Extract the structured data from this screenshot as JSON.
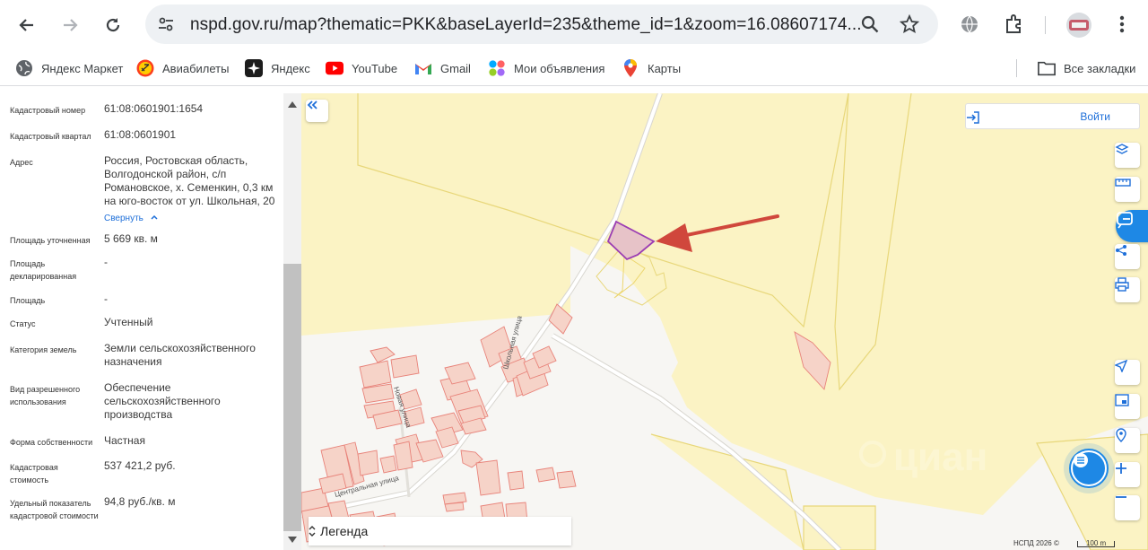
{
  "browser": {
    "url": "nspd.gov.ru/map?thematic=PKK&baseLayerId=235&theme_id=1&zoom=16.08607174...",
    "bookmarks": [
      {
        "label": "Яндекс Маркет",
        "icon": "globe-icon"
      },
      {
        "label": "Авиабилеты",
        "icon": "flight-icon"
      },
      {
        "label": "Яндекс",
        "icon": "yandex-icon"
      },
      {
        "label": "YouTube",
        "icon": "youtube-icon"
      },
      {
        "label": "Gmail",
        "icon": "gmail-icon"
      },
      {
        "label": "Мои объявления",
        "icon": "dots-icon"
      },
      {
        "label": "Карты",
        "icon": "maps-pin-icon"
      }
    ],
    "all_bookmarks_label": "Все закладки"
  },
  "panel": {
    "rows": [
      {
        "label": "Кадастровый номер",
        "value": "61:08:0601901:1654"
      },
      {
        "label": "Кадастровый квартал",
        "value": "61:08:0601901"
      },
      {
        "label": "Адрес",
        "value": "Россия, Ростовская область, Волгодонской район, с/п Романовское, х. Семенкин, 0,3 км на юго-восток от ул. Школьная, 20",
        "link": "Свернуть"
      },
      {
        "label": "Площадь уточненная",
        "value": "5 669 кв. м"
      },
      {
        "label": "Площадь декларированная",
        "value": "-"
      },
      {
        "label": "Площадь",
        "value": "-"
      },
      {
        "label": "Статус",
        "value": "Учтенный"
      },
      {
        "label": "Категория земель",
        "value": "Земли сельскохозяйственного назначения"
      },
      {
        "label": "Вид разрешенного использования",
        "value": "Обеспечение сельскохозяйственного производства"
      },
      {
        "label": "Форма собственности",
        "value": "Частная"
      },
      {
        "label": "Кадастровая стоимость",
        "value": "537 421,2 руб."
      },
      {
        "label": "Удельный показатель кадастровой стоимости",
        "value": "94,8 руб./кв. м"
      }
    ]
  },
  "map": {
    "login_label": "Войти",
    "legend_label": "Легенда",
    "street_labels": [
      "Новая улица",
      "Школьная улица",
      "Центральная улица"
    ],
    "copyright": "НСПД 2026 ©",
    "scale_label": "100 m",
    "watermark": "циан",
    "colors": {
      "land": "#fbf3c4",
      "parcel_fill": "#f6d3c8",
      "parcel_stroke": "#e8837a",
      "selected": "#9b3db3",
      "arrow": "#d0473c"
    }
  }
}
